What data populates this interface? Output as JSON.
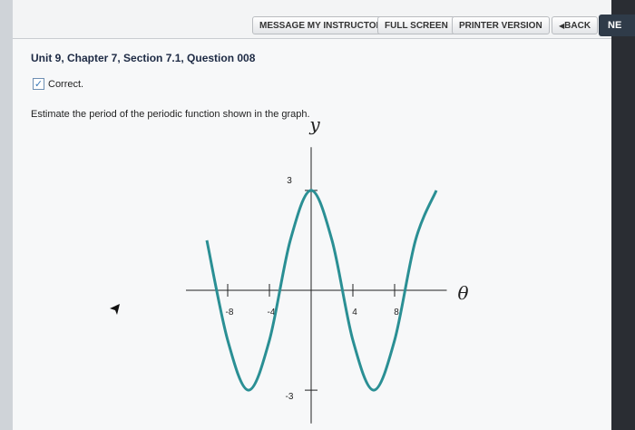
{
  "toolbar": {
    "message_instructor": "MESSAGE MY INSTRUCTOR",
    "full_screen": "FULL SCREEN",
    "printer_version": "PRINTER VERSION",
    "back": "BACK",
    "back_icon": "triangle-left-icon",
    "next": "NE"
  },
  "question": {
    "title": "Unit 9, Chapter 7, Section 7.1, Question 008",
    "status": "Correct.",
    "prompt": "Estimate the period of the periodic function shown in the graph."
  },
  "colors": {
    "curve": "#2a8f94",
    "next_button": "#2f3b49",
    "title": "#1d2a44"
  },
  "chart_data": {
    "type": "line",
    "xlabel": "θ",
    "ylabel": "y",
    "x_ticks": [
      -8,
      -4,
      4,
      8
    ],
    "y_ticks": [
      3,
      -3
    ],
    "xlim": [
      -12,
      13
    ],
    "ylim": [
      -4,
      4.3
    ],
    "series": [
      {
        "function": "3cos(πθ/6)",
        "x": [
          -10,
          -8,
          -6,
          -4,
          -2,
          0,
          2,
          4,
          6,
          8,
          10,
          12
        ],
        "values": [
          1.5,
          -1.5,
          -3,
          -1.5,
          1.5,
          3,
          1.5,
          -1.5,
          -3,
          -1.5,
          1.5,
          3
        ]
      }
    ]
  }
}
